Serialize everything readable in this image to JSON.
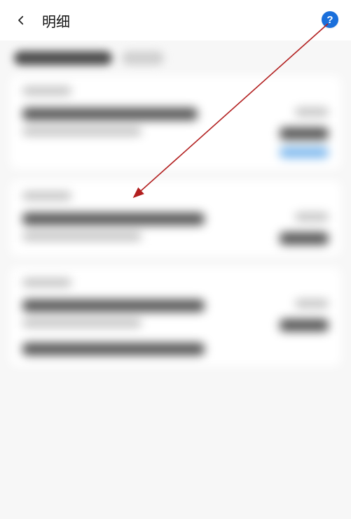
{
  "header": {
    "title": "明细",
    "help_symbol": "?"
  }
}
